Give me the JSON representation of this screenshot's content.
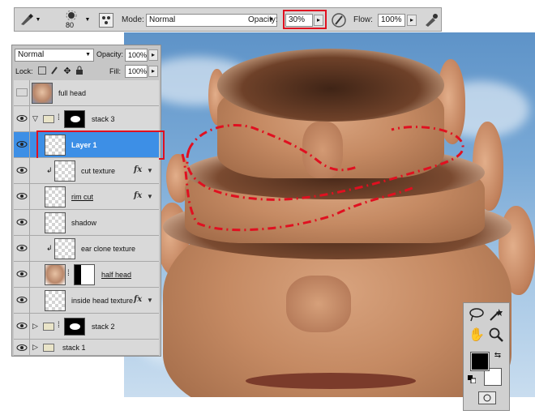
{
  "options_bar": {
    "brush_size": "80",
    "mode_label": "Mode:",
    "mode_value": "Normal",
    "opacity_label": "Opacity:",
    "opacity_value": "30%",
    "flow_label": "Flow:",
    "flow_value": "100%",
    "icons": [
      "brush-tool-icon",
      "brush-preset-icon",
      "brush-panel-toggle-icon",
      "tablet-pressure-opacity-icon",
      "airbrush-icon"
    ]
  },
  "layers_panel": {
    "blend_mode": "Normal",
    "opacity_label": "Opacity:",
    "opacity_value": "100%",
    "lock_label": "Lock:",
    "fill_label": "Fill:",
    "fill_value": "100%",
    "layers": [
      {
        "name": "full head",
        "visible": false
      },
      {
        "name": "stack 3",
        "visible": true,
        "group": true,
        "expanded": true
      },
      {
        "name": "Layer 1",
        "visible": true,
        "selected": true
      },
      {
        "name": "cut texture",
        "visible": true,
        "clipped": true,
        "fx": "fx"
      },
      {
        "name": "rim cut",
        "visible": true,
        "fx": "fx"
      },
      {
        "name": "shadow",
        "visible": true
      },
      {
        "name": "ear clone texture",
        "visible": true,
        "clipped": true
      },
      {
        "name": "half head",
        "visible": true
      },
      {
        "name": "inside head texture",
        "visible": true,
        "fx": "fx"
      },
      {
        "name": "stack 2",
        "visible": true,
        "group": true
      },
      {
        "name": "stack 1",
        "visible": true,
        "group": true
      }
    ]
  },
  "tools_panel": {
    "icons": [
      "lasso-tool-icon",
      "magic-wand-icon",
      "hand-tool-icon",
      "zoom-tool-icon",
      "foreground-color-swatch",
      "background-color-swatch",
      "swap-colors-icon",
      "default-colors-icon",
      "quick-mask-icon"
    ],
    "foreground_color": "#000000",
    "background_color": "#ffffff"
  },
  "colors": {
    "selection_highlight": "#3d8fe6",
    "annotation_red": "#e01020"
  }
}
